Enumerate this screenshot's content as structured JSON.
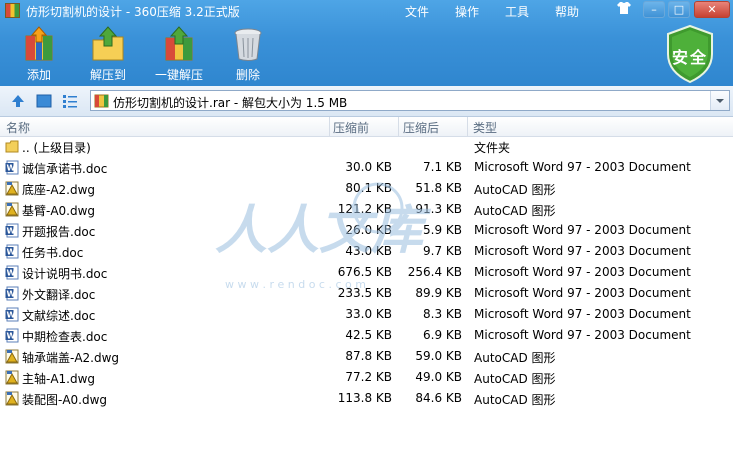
{
  "window": {
    "title": "仿形切割机的设计 - 360压缩 3.2正式版",
    "menu": [
      "文件",
      "操作",
      "工具",
      "帮助"
    ],
    "controls": [
      "shirt-icon",
      "minimize-icon",
      "maximize-icon",
      "close-icon"
    ]
  },
  "toolbar": {
    "buttons": [
      {
        "label": "添加",
        "icon": "add-archive-icon"
      },
      {
        "label": "解压到",
        "icon": "extract-to-folder-icon"
      },
      {
        "label": "一键解压",
        "icon": "one-click-extract-icon"
      },
      {
        "label": "删除",
        "icon": "trash-can-icon"
      }
    ],
    "security_badge": "安全"
  },
  "address": {
    "path": "仿形切割机的设计.rar - 解包大小为 1.5 MB"
  },
  "columns": {
    "name": "名称",
    "compressed": "压缩前",
    "after": "压缩后",
    "type": "类型"
  },
  "files": [
    {
      "name": ".. (上级目录)",
      "before": "",
      "after": "",
      "type": "文件夹",
      "icon": "folder"
    },
    {
      "name": "诚信承诺书.doc",
      "before": "30.0 KB",
      "after": "7.1 KB",
      "type": "Microsoft Word 97 - 2003 Document",
      "icon": "doc"
    },
    {
      "name": "底座-A2.dwg",
      "before": "80.1 KB",
      "after": "51.8 KB",
      "type": "AutoCAD 图形",
      "icon": "dwg"
    },
    {
      "name": "基臂-A0.dwg",
      "before": "121.2 KB",
      "after": "91.3 KB",
      "type": "AutoCAD 图形",
      "icon": "dwg"
    },
    {
      "name": "开题报告.doc",
      "before": "26.0 KB",
      "after": "5.9 KB",
      "type": "Microsoft Word 97 - 2003 Document",
      "icon": "doc"
    },
    {
      "name": "任务书.doc",
      "before": "43.0 KB",
      "after": "9.7 KB",
      "type": "Microsoft Word 97 - 2003 Document",
      "icon": "doc"
    },
    {
      "name": "设计说明书.doc",
      "before": "676.5 KB",
      "after": "256.4 KB",
      "type": "Microsoft Word 97 - 2003 Document",
      "icon": "doc"
    },
    {
      "name": "外文翻译.doc",
      "before": "233.5 KB",
      "after": "89.9 KB",
      "type": "Microsoft Word 97 - 2003 Document",
      "icon": "doc"
    },
    {
      "name": "文献综述.doc",
      "before": "33.0 KB",
      "after": "8.3 KB",
      "type": "Microsoft Word 97 - 2003 Document",
      "icon": "doc"
    },
    {
      "name": "中期检查表.doc",
      "before": "42.5 KB",
      "after": "6.9 KB",
      "type": "Microsoft Word 97 - 2003 Document",
      "icon": "doc"
    },
    {
      "name": "轴承端盖-A2.dwg",
      "before": "87.8 KB",
      "after": "59.0 KB",
      "type": "AutoCAD 图形",
      "icon": "dwg"
    },
    {
      "name": "主轴-A1.dwg",
      "before": "77.2 KB",
      "after": "49.0 KB",
      "type": "AutoCAD 图形",
      "icon": "dwg"
    },
    {
      "name": "装配图-A0.dwg",
      "before": "113.8 KB",
      "after": "84.6 KB",
      "type": "AutoCAD 图形",
      "icon": "dwg"
    }
  ],
  "watermark": {
    "text": "人人文库",
    "url": "w w w . r e n d o c . c o m"
  },
  "colors": {
    "title_bar": "#3a91d8",
    "security_green": "#3f9a2e",
    "header_text": "#5a6d82"
  }
}
